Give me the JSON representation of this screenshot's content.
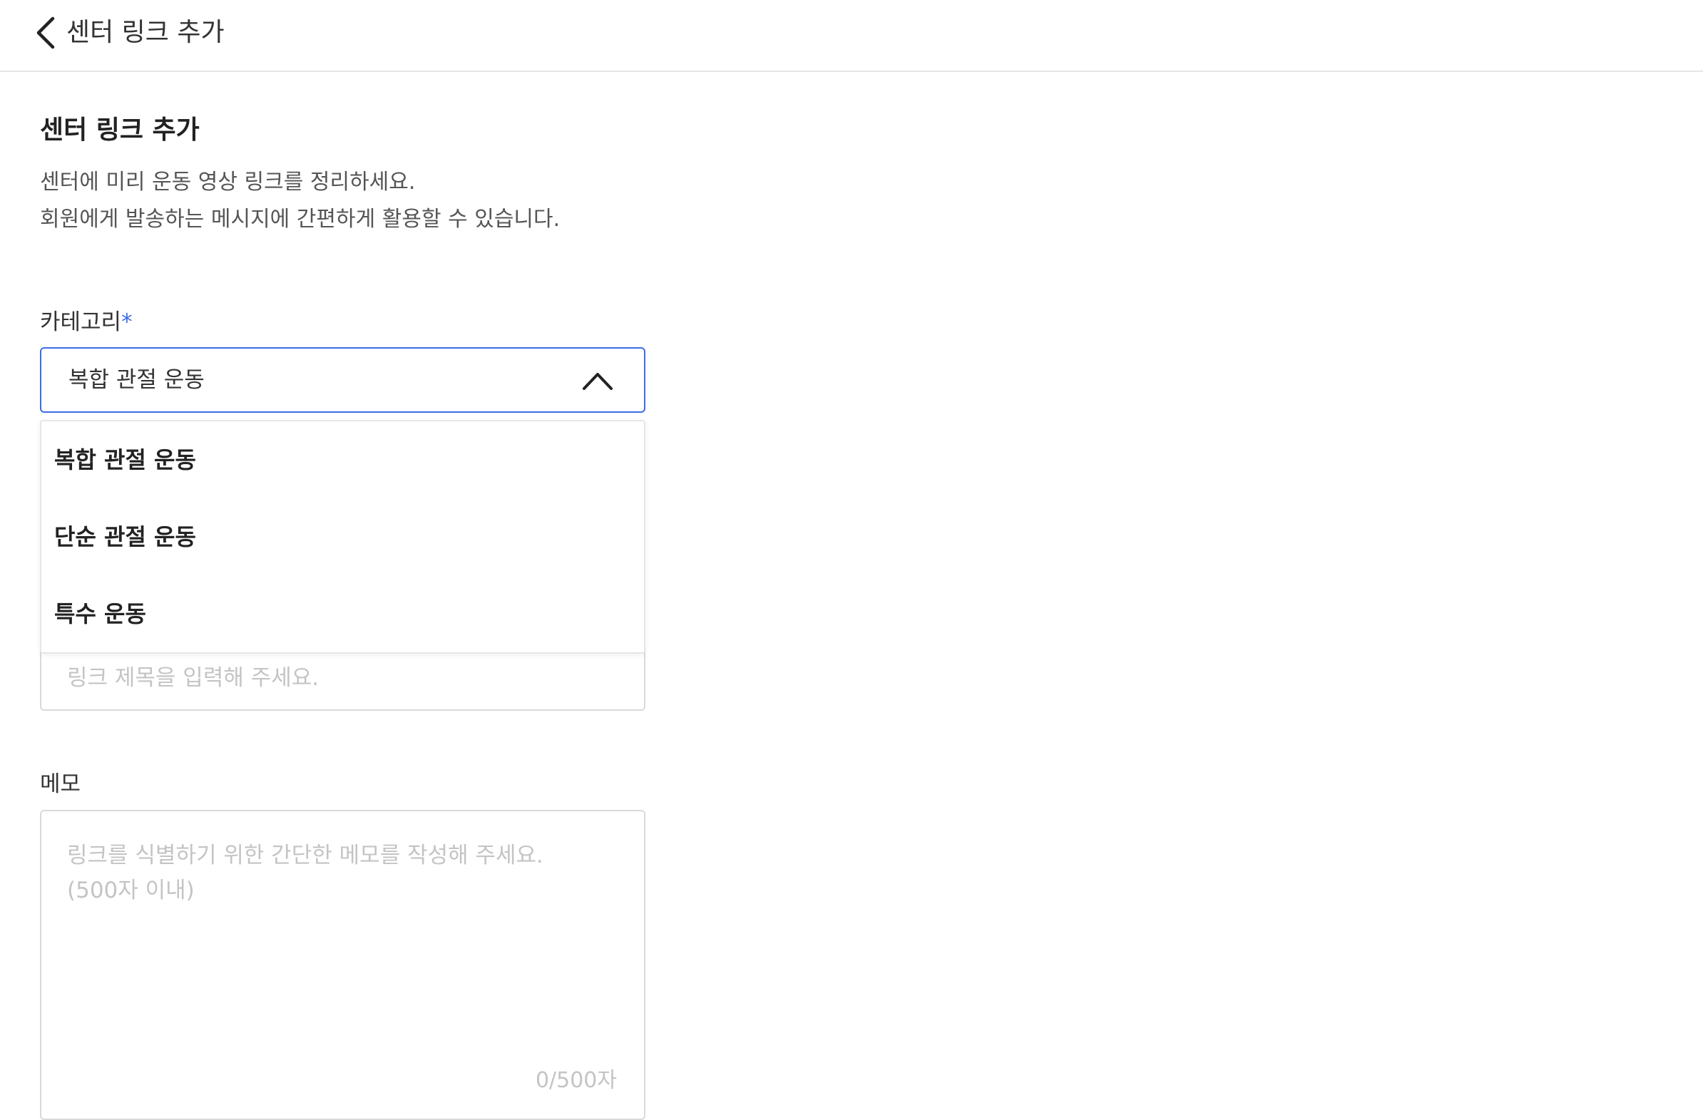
{
  "header": {
    "title": "센터 링크 추가",
    "back_icon": "chevron-left-icon"
  },
  "page": {
    "title": "센터 링크 추가",
    "description_line1": "센터에 미리 운동 영상 링크를 정리하세요.",
    "description_line2": "회원에게 발송하는 메시지에 간편하게 활용할 수 있습니다."
  },
  "category": {
    "label": "카테고리",
    "required_mark": "*",
    "selected": "복합 관절 운동",
    "toggle_icon": "chevron-up-icon",
    "options": [
      {
        "label": "복합 관절 운동"
      },
      {
        "label": "단순 관절 운동"
      },
      {
        "label": "특수 운동"
      }
    ]
  },
  "link_title": {
    "placeholder": "링크 제목을 입력해 주세요."
  },
  "memo": {
    "label": "메모",
    "placeholder": "링크를 식별하기 위한 간단한 메모를 작성해 주세요.\n(500자 이내)",
    "counter": "0/500자"
  },
  "colors": {
    "accent": "#3d6ce7",
    "border": "#d9d9d9",
    "placeholder": "#c4c4c4",
    "text": "#222222"
  }
}
